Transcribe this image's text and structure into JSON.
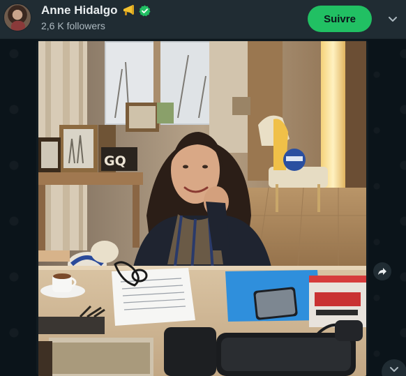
{
  "channel": {
    "name": "Anne Hidalgo",
    "followers": "2,6 K followers",
    "follow_label": "Suivre",
    "name_emoji": "megaphone-icon",
    "verified_badge": "verified-icon"
  },
  "post": {
    "media_type": "photo",
    "photo_text": {
      "gq_sign": "GQ"
    }
  },
  "colors": {
    "header_bg": "#202c33",
    "chat_bg": "#0b141a",
    "follow_button": "#21c063",
    "verified": "#21c063",
    "text_primary": "#e9edef",
    "text_secondary": "#aebac1"
  },
  "icons": {
    "menu": "chevron-down-icon",
    "forward": "forward-icon",
    "scroll_down": "chevron-down-icon"
  }
}
